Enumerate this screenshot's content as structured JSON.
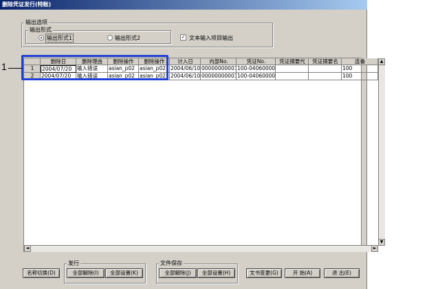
{
  "window": {
    "title": "删除凭证发行(特账)"
  },
  "options": {
    "group_label": "输出选项",
    "format_label": "输出形式",
    "radio1_label": "输出形式1",
    "radio2_label": "输出形式2",
    "checkbox_label": "文本输入项目输出",
    "checkbox_checked": true,
    "checkbox_mark": "✓"
  },
  "grid": {
    "columns": [
      "删除日",
      "删除理由",
      "删除操作",
      "删除操作",
      "计入日",
      "内部No.",
      "凭证No.",
      "凭证摘要代",
      "凭证摘要名",
      "连番"
    ],
    "rows": [
      {
        "num": "1",
        "cells": [
          "2004/07/20",
          "输入错误",
          "asian_p02",
          "asian_p02",
          "2004/06/10",
          "00000000001",
          "100-04060000",
          "",
          "",
          "100"
        ]
      },
      {
        "num": "2",
        "cells": [
          "2004/07/20",
          "输入错误",
          "asian_p02",
          "asian_p02",
          "2004/06/10",
          "00000000001",
          "100-04060000",
          "",
          "",
          "100"
        ]
      }
    ]
  },
  "buttons": {
    "name_switch": "名称切换(D)",
    "issue_group": "发行",
    "issue_clear_all": "全部解除(I)",
    "issue_set_all": "全部设置(K)",
    "save_group": "文件保存",
    "save_clear_all": "全部解除(J)",
    "save_set_all": "全部设置(H)",
    "doc_change": "文书变更(G)",
    "start": "开 始(A)",
    "exit": "退 出(E)"
  },
  "scroll": {
    "up": "▲",
    "down": "▼",
    "left": "◄",
    "right": "►"
  },
  "callout": {
    "number": "1"
  },
  "colors": {
    "highlight": "#1f3fd6",
    "titlebar": "#0a246a"
  }
}
